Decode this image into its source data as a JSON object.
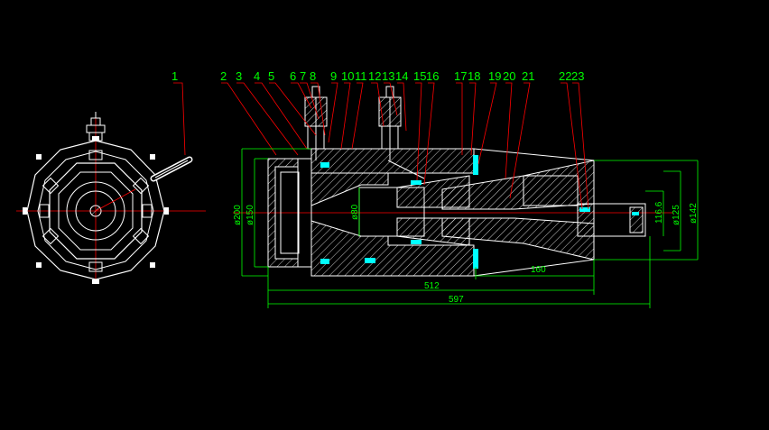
{
  "part_numbers": [
    "1",
    "2",
    "3",
    "4",
    "5",
    "6",
    "7",
    "8",
    "9",
    "10",
    "11",
    "12",
    "13",
    "14",
    "15",
    "16",
    "17",
    "18",
    "19",
    "20",
    "21",
    "22",
    "23"
  ],
  "dimensions": {
    "d200": "ø200",
    "d150": "ø150",
    "d80": "ø80",
    "d116": "116.6",
    "d125": "ø125",
    "d142": "ø142",
    "l160": "160",
    "l512": "512",
    "l597": "597"
  },
  "colors": {
    "background": "#000000",
    "outline": "#ffffff",
    "leader": "#ff0000",
    "dimension": "#00ff00",
    "label": "#00ff00",
    "hatch": "#ffffff",
    "seal": "#00ffff",
    "centerline": "#ff0000"
  }
}
